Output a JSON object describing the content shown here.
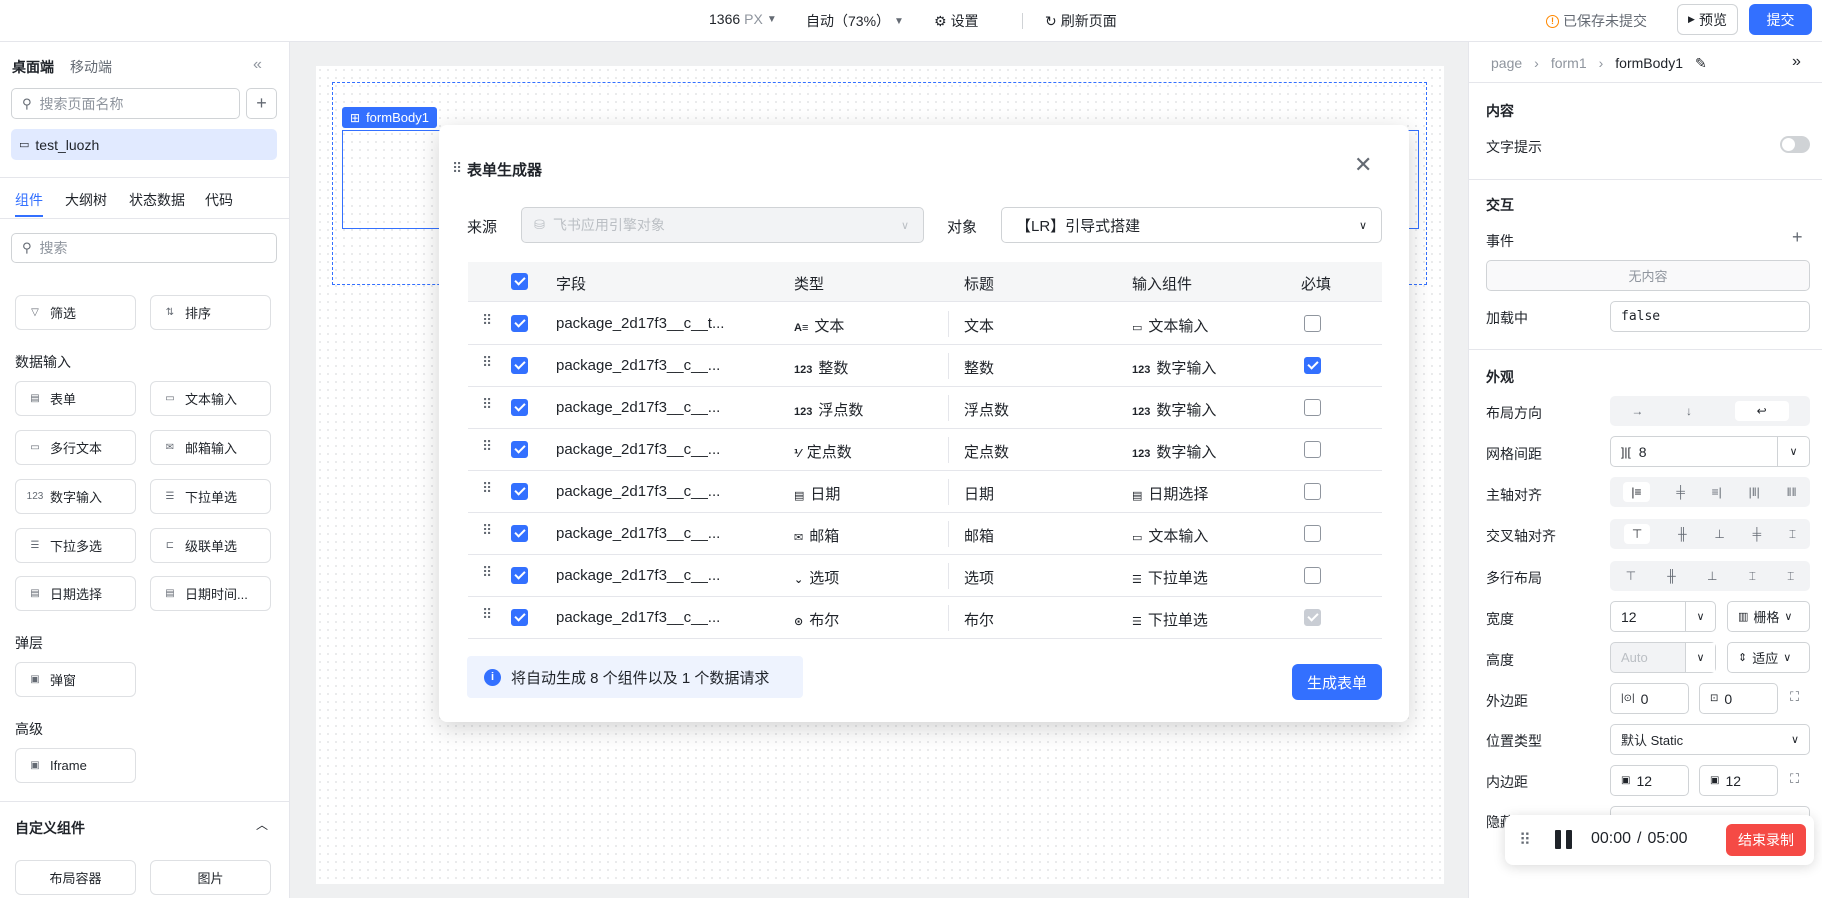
{
  "topbar": {
    "width_value": "1366",
    "width_unit": "PX",
    "zoom": "自动（73%）",
    "settings": "设置",
    "refresh": "刷新页面",
    "save_status": "已保存未提交",
    "preview": "预览",
    "submit": "提交"
  },
  "left": {
    "tabs": [
      "桌面端",
      "移动端"
    ],
    "search_page_placeholder": "搜索页面名称",
    "page_item": "test_luozh",
    "panel_tabs": [
      "组件",
      "大纲树",
      "状态数据",
      "代码"
    ],
    "search_placeholder": "搜索",
    "filter": "筛选",
    "sort": "排序",
    "section_input": "数据输入",
    "comps_input": [
      "表单",
      "文本输入",
      "多行文本",
      "邮箱输入",
      "数字输入",
      "下拉单选",
      "下拉多选",
      "级联单选",
      "日期选择",
      "日期时间..."
    ],
    "section_layer": "弹层",
    "dialog": "弹窗",
    "section_advanced": "高级",
    "iframe": "Iframe",
    "custom_title": "自定义组件",
    "custom_items": [
      "布局容器",
      "图片"
    ]
  },
  "canvas": {
    "form_label": "formBody1"
  },
  "modal": {
    "title": "表单生成器",
    "source_label": "来源",
    "source_value": "飞书应用引擎对象",
    "object_label": "对象",
    "object_value": "【LR】引导式搭建",
    "headers": [
      "字段",
      "类型",
      "标题",
      "输入组件",
      "必填"
    ],
    "rows": [
      {
        "field": "package_2d17f3__c__t...",
        "type_icon": "A≡",
        "type": "文本",
        "title": "文本",
        "input_icon": "▭",
        "input": "文本输入",
        "required": "off"
      },
      {
        "field": "package_2d17f3__c__...",
        "type_icon": "123",
        "type": "整数",
        "title": "整数",
        "input_icon": "123",
        "input": "数字输入",
        "required": "on"
      },
      {
        "field": "package_2d17f3__c__...",
        "type_icon": "123",
        "type": "浮点数",
        "title": "浮点数",
        "input_icon": "123",
        "input": "数字输入",
        "required": "off"
      },
      {
        "field": "package_2d17f3__c__...",
        "type_icon": "⅟",
        "type": "定点数",
        "title": "定点数",
        "input_icon": "123",
        "input": "数字输入",
        "required": "off"
      },
      {
        "field": "package_2d17f3__c__...",
        "type_icon": "▤",
        "type": "日期",
        "title": "日期",
        "input_icon": "▤",
        "input": "日期选择",
        "required": "off"
      },
      {
        "field": "package_2d17f3__c__...",
        "type_icon": "✉",
        "type": "邮箱",
        "title": "邮箱",
        "input_icon": "▭",
        "input": "文本输入",
        "required": "off"
      },
      {
        "field": "package_2d17f3__c__...",
        "type_icon": "⌄",
        "type": "选项",
        "title": "选项",
        "input_icon": "☰",
        "input": "下拉单选",
        "required": "off"
      },
      {
        "field": "package_2d17f3__c__...",
        "type_icon": "⊙",
        "type": "布尔",
        "title": "布尔",
        "input_icon": "☰",
        "input": "下拉单选",
        "required": "disabled"
      }
    ],
    "info": "将自动生成 8 个组件以及 1 个数据请求",
    "generate": "生成表单"
  },
  "right": {
    "breadcrumb": [
      "page",
      "form1",
      "formBody1"
    ],
    "section_content": "内容",
    "text_hint": "文字提示",
    "section_interact": "交互",
    "event": "事件",
    "no_content": "无内容",
    "loading": "加载中",
    "loading_value": "false",
    "section_look": "外观",
    "layout_dir": "布局方向",
    "grid_gap": "网格间距",
    "grid_gap_value": "8",
    "main_align": "主轴对齐",
    "cross_align": "交叉轴对齐",
    "multi_layout": "多行布局",
    "width": "宽度",
    "width_value": "12",
    "width_mode": "栅格",
    "height": "高度",
    "height_value": "Auto",
    "height_mode": "适应",
    "margin": "外边距",
    "margin_a": "0",
    "margin_b": "0",
    "position_type": "位置类型",
    "position_value": "默认 Static",
    "padding": "内边距",
    "padding_a": "12",
    "padding_b": "12",
    "hidden": "隐藏"
  },
  "recorder": {
    "elapsed": "00:00",
    "sep": "/",
    "total": "05:00",
    "stop": "结束录制"
  },
  "colors": {
    "accent": "#3370ff",
    "danger": "#f54a45",
    "warning": "#ff8800"
  }
}
